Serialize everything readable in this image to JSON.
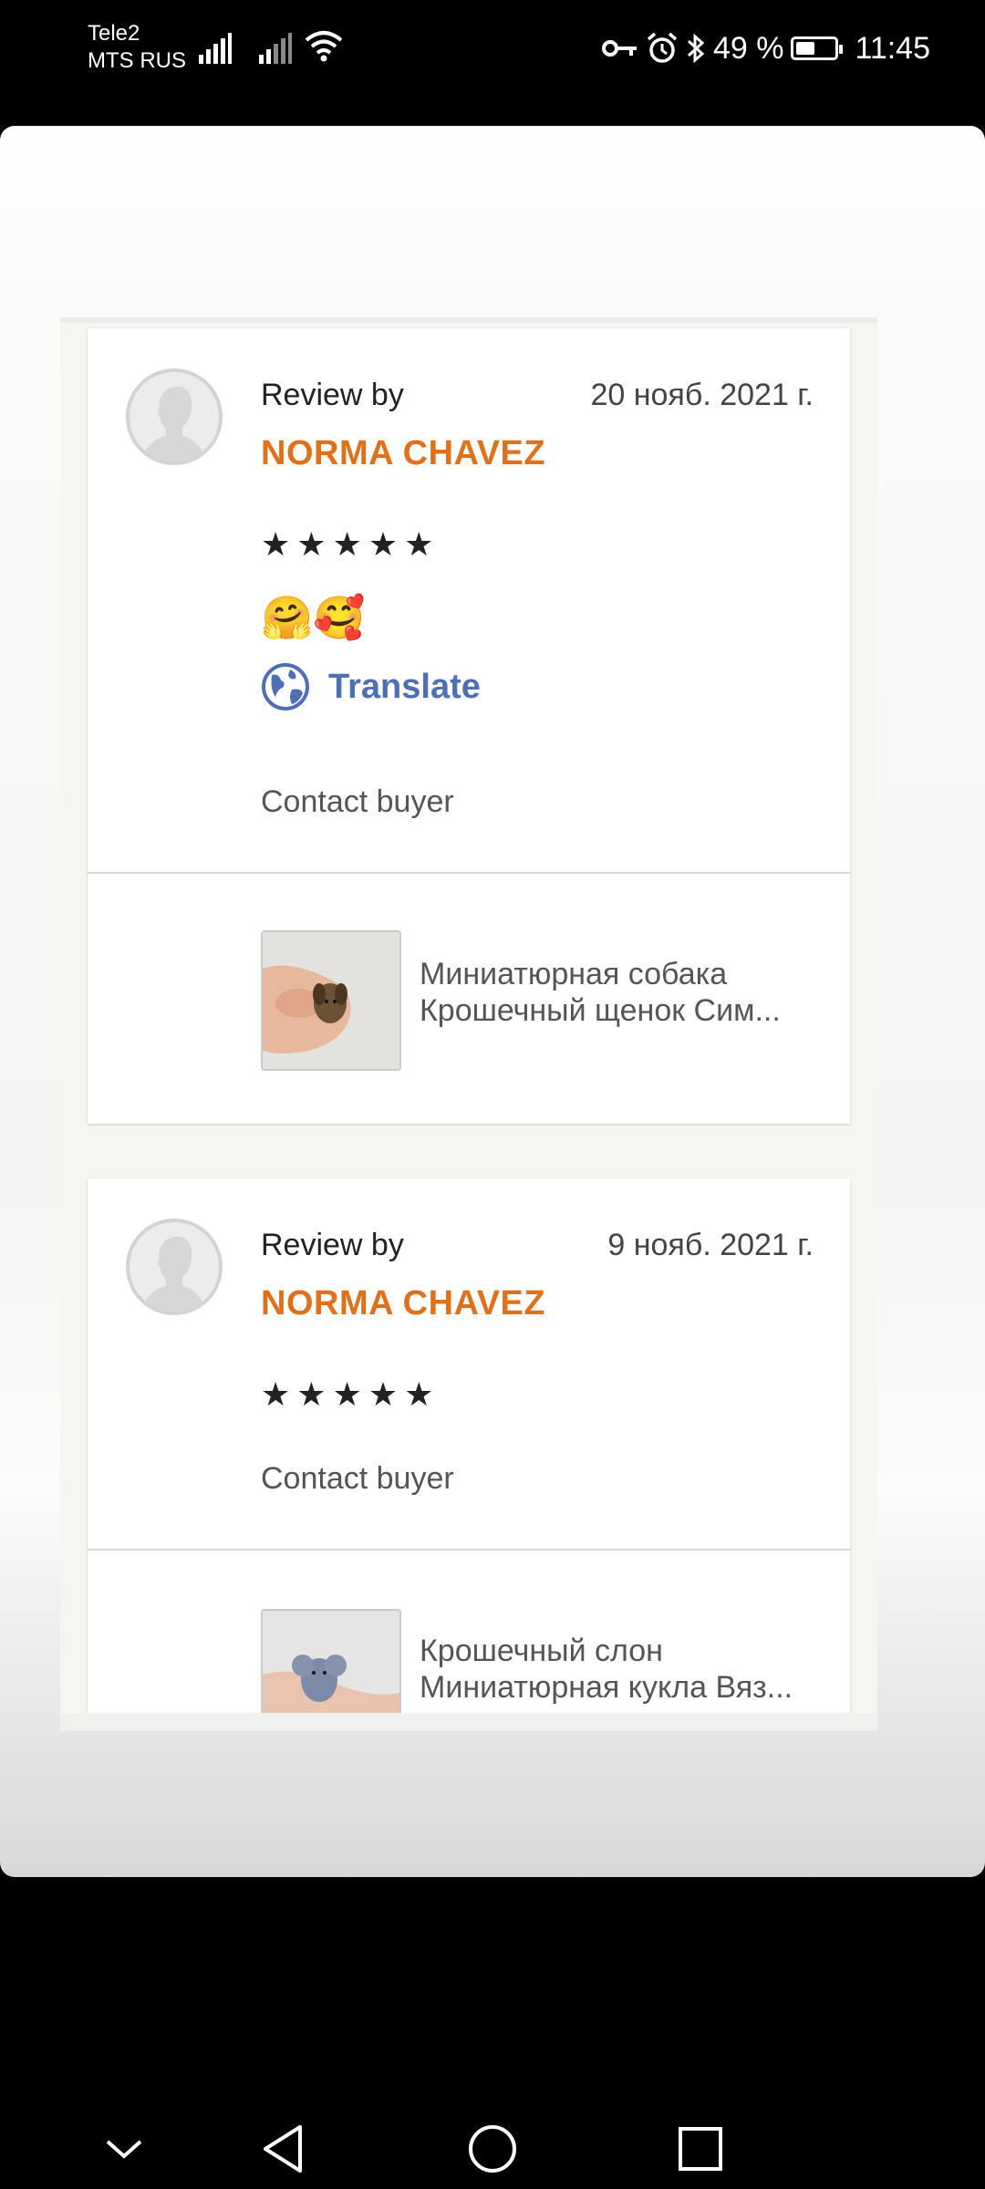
{
  "status_bar": {
    "carrier1": "Tele2",
    "carrier2": "MTS RUS",
    "battery_text": "49 %",
    "battery_level": 0.49,
    "time": "11:45",
    "icons": [
      "signal-icon",
      "signal-icon",
      "wifi-icon",
      "key-icon",
      "alarm-icon",
      "bluetooth-icon",
      "battery-icon"
    ]
  },
  "reviews": [
    {
      "review_by": "Review by",
      "date": "20 нояб. 2021 г.",
      "name": "NORMA CHAVEZ",
      "stars": "★★★★★",
      "rating": 5,
      "emoji": "🤗🥰",
      "translate": "Translate",
      "contact": "Contact buyer",
      "product_line1": "Миниатюрная собака",
      "product_line2": "Крошечный щенок Сим..."
    },
    {
      "review_by": "Review by",
      "date": "9 нояб. 2021 г.",
      "name": "NORMA CHAVEZ",
      "stars": "★★★★★",
      "rating": 5,
      "contact": "Contact buyer",
      "product_line1": "Крошечный слон",
      "product_line2": "Миниатюрная кукла Вяз..."
    }
  ],
  "colors": {
    "name_accent": "#e0711c",
    "translate_blue": "#4e6fb4"
  },
  "nav_bar": {
    "icons": [
      "chevron-down-icon",
      "back-icon",
      "home-icon",
      "recents-icon"
    ]
  }
}
